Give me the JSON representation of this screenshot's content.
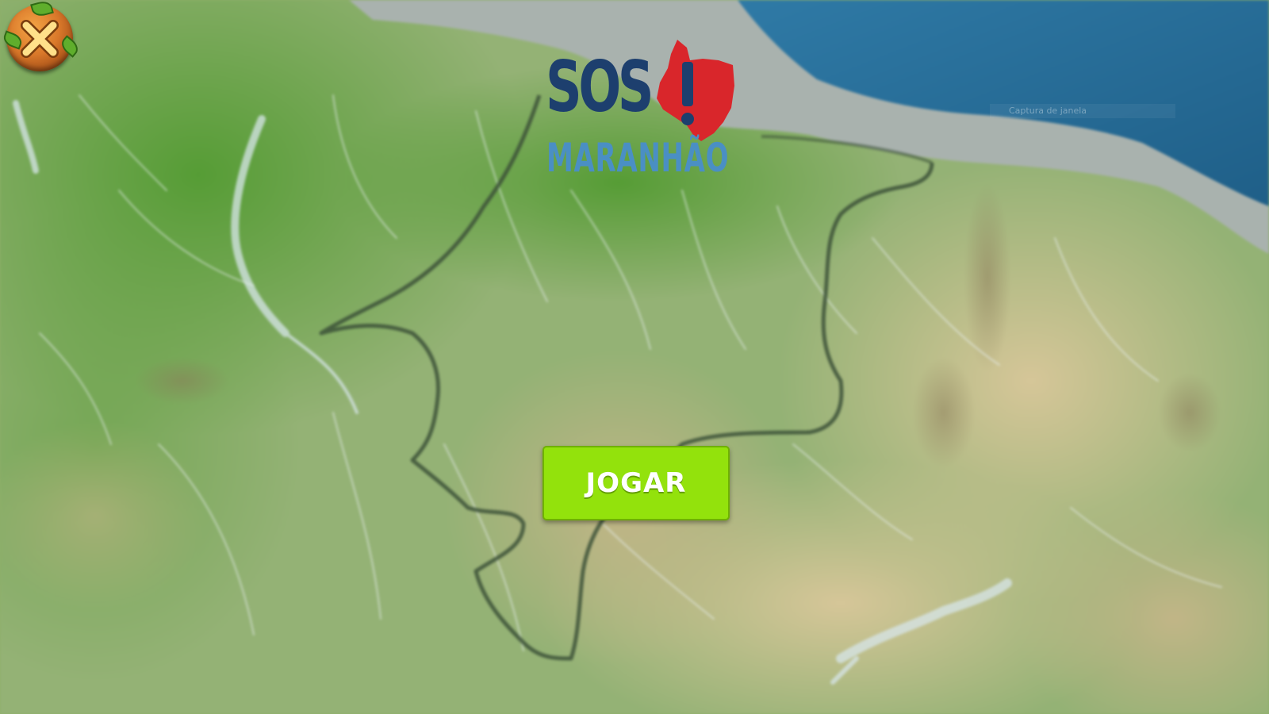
{
  "game": {
    "logo": {
      "title_main": "SOS",
      "title_sub": "MARANHÃO"
    },
    "play_button_label": "JOGAR",
    "close_button": {
      "icon": "close-x-icon"
    },
    "overlay_caption": "Captura de janela"
  },
  "colors": {
    "logo_dark_blue": "#1d3f6e",
    "logo_light_blue": "#4a8fc4",
    "logo_red": "#d9262b",
    "play_button_green": "#93e20c",
    "close_button_orange": "#e28a2e",
    "sea_blue": "#2a6f9a",
    "land_green": "#6ea64a"
  },
  "background": {
    "type": "relief map",
    "description_icon": "map-background"
  }
}
